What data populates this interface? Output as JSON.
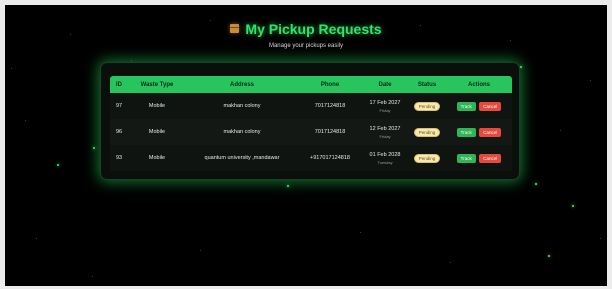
{
  "header": {
    "title": "My Pickup Requests",
    "subtitle": "Manage your pickups easily"
  },
  "table": {
    "columns": [
      "ID",
      "Waste Type",
      "Address",
      "Phone",
      "Date",
      "Status",
      "Actions"
    ],
    "rows": [
      {
        "id": "97",
        "waste_type": "Mobile",
        "address": "makhan colony",
        "phone": "7017124818",
        "date": "17 Feb 2027",
        "day": "Friday",
        "status": "Pending",
        "track": "Track",
        "cancel": "Cancel"
      },
      {
        "id": "96",
        "waste_type": "Mobile",
        "address": "makhan colony",
        "phone": "7017124818",
        "date": "12 Feb 2027",
        "day": "Friday",
        "status": "Pending",
        "track": "Track",
        "cancel": "Cancel"
      },
      {
        "id": "93",
        "waste_type": "Mobile",
        "address": "quantum university ,mandawar",
        "phone": "+917017124818",
        "date": "01 Feb 2028",
        "day": "Tuesday",
        "status": "Pending",
        "track": "Track",
        "cancel": "Cancel"
      }
    ]
  },
  "colors": {
    "accent": "#2ee56a",
    "header_bg": "#28c45e",
    "track": "#2fb555",
    "cancel": "#e64a3c",
    "pending_badge": "#f7e9b0"
  }
}
